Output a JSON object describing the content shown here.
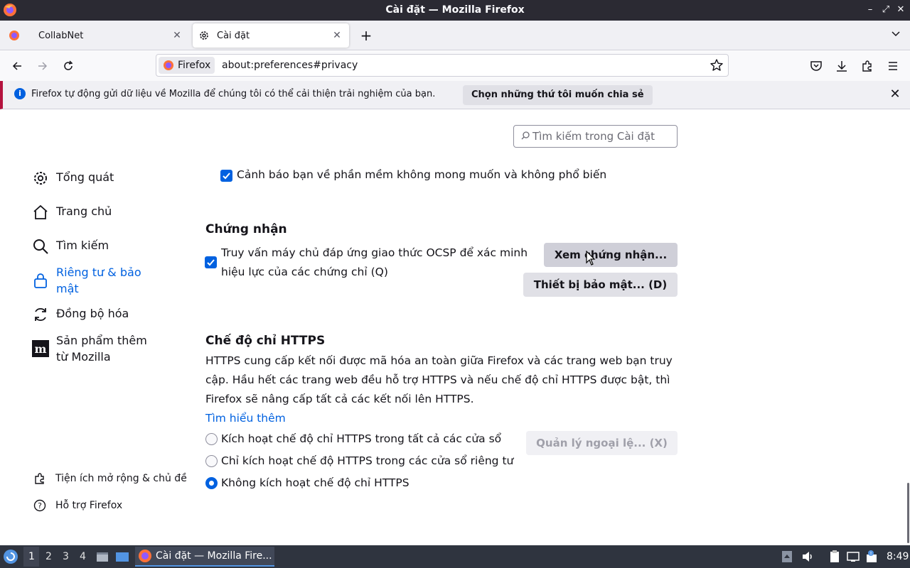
{
  "window": {
    "title": "Cài đặt — Mozilla Firefox"
  },
  "tabs": [
    {
      "label": "CollabNet",
      "icon": "firefox-icon",
      "active": false
    },
    {
      "label": "Cài đặt",
      "icon": "gear-icon",
      "active": true
    }
  ],
  "navbar": {
    "identity_label": "Firefox",
    "url": "about:preferences#privacy"
  },
  "notification": {
    "message": "Firefox tự động gửi dữ liệu về Mozilla để chúng tôi có thể cải thiện trải nghiệm của bạn.",
    "button_label": "Chọn những thứ tôi muốn chia sẻ"
  },
  "search": {
    "placeholder": "Tìm kiếm trong Cài đặt"
  },
  "sidebar": {
    "categories": [
      {
        "label": "Tổng quát",
        "icon": "gear-icon"
      },
      {
        "label": "Trang chủ",
        "icon": "home-icon"
      },
      {
        "label": "Tìm kiếm",
        "icon": "search-icon"
      },
      {
        "label": "Riêng tư & bảo mật",
        "icon": "lock-icon",
        "selected": true
      },
      {
        "label": "Đồng bộ hóa",
        "icon": "sync-icon"
      },
      {
        "label": "Sản phẩm thêm từ Mozilla",
        "icon": "mozilla-icon"
      }
    ],
    "footer": [
      {
        "label": "Tiện ích mở rộng & chủ đề",
        "icon": "puzzle-icon"
      },
      {
        "label": "Hỗ trợ Firefox",
        "icon": "help-icon"
      }
    ]
  },
  "main": {
    "warn_unwanted": {
      "label": "Cảnh báo bạn về phần mềm không mong muốn và không phổ biến",
      "checked": true
    },
    "certificates": {
      "heading": "Chứng nhận",
      "ocsp_line1": "Truy vấn máy chủ đáp ứng giao thức OCSP để xác minh",
      "ocsp_line2": "hiệu lực của các chứng chỉ (Q)",
      "ocsp_checked": true,
      "view_button": "Xem chứng nhận...",
      "devices_button": "Thiết bị bảo mật... (D)"
    },
    "https_only": {
      "heading": "Chế độ chỉ HTTPS",
      "desc_line1": "HTTPS cung cấp kết nối được mã hóa an toàn giữa Firefox và các trang web bạn truy",
      "desc_line2": "cập. Hầu hết các trang web đều hỗ trợ HTTPS và nếu chế độ chỉ HTTPS được bật, thì",
      "desc_line3": "Firefox sẽ nâng cấp tất cả các kết nối lên HTTPS.",
      "learn_more": "Tìm hiểu thêm",
      "options": [
        {
          "label": "Kích hoạt chế độ chỉ HTTPS trong tất cả các cửa sổ",
          "checked": false
        },
        {
          "label": "Chỉ kích hoạt chế độ HTTPS trong các cửa sổ riêng tư",
          "checked": false
        },
        {
          "label": "Không kích hoạt chế độ chỉ HTTPS",
          "checked": true
        }
      ],
      "exceptions_button": "Quản lý ngoại lệ... (X)"
    }
  },
  "taskbar": {
    "workspaces": [
      "1",
      "2",
      "3",
      "4"
    ],
    "task_label": "Cài đặt — Mozilla Fire...",
    "clock": "8:49"
  },
  "colors": {
    "accent": "#0061e0",
    "titlebar": "#2b2a33",
    "taskbar": "#2f343f"
  }
}
